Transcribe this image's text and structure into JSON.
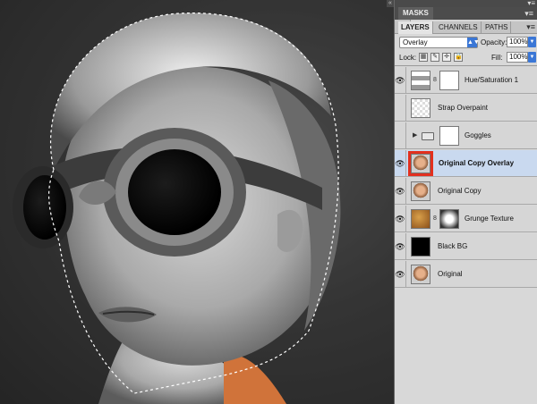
{
  "panel": {
    "masks_tab": "MASKS",
    "tabs": [
      "LAYERS",
      "CHANNELS",
      "PATHS"
    ],
    "blend_mode": "Overlay",
    "opacity_label": "Opacity:",
    "opacity_value": "100%",
    "lock_label": "Lock:",
    "fill_label": "Fill:",
    "fill_value": "100%"
  },
  "layers": [
    {
      "name": "Hue/Saturation 1",
      "visible": true,
      "selected": false
    },
    {
      "name": "Strap Overpaint",
      "visible": false,
      "selected": false
    },
    {
      "name": "Goggles",
      "visible": false,
      "selected": false
    },
    {
      "name": "Original Copy Overlay",
      "visible": true,
      "selected": true
    },
    {
      "name": "Original Copy",
      "visible": true,
      "selected": false
    },
    {
      "name": "Grunge Texture",
      "visible": true,
      "selected": false
    },
    {
      "name": "Black BG",
      "visible": true,
      "selected": false
    },
    {
      "name": "Original",
      "visible": true,
      "selected": false
    }
  ],
  "icons": {
    "eye": "eye-icon",
    "chain": "link-icon",
    "folder": "folder-icon",
    "panel_menu": "panel-menu-icon"
  },
  "colors": {
    "selection_highlight": "#c9d9ef",
    "callout_red": "#e2301f",
    "accent_blue": "#3b77d6"
  }
}
